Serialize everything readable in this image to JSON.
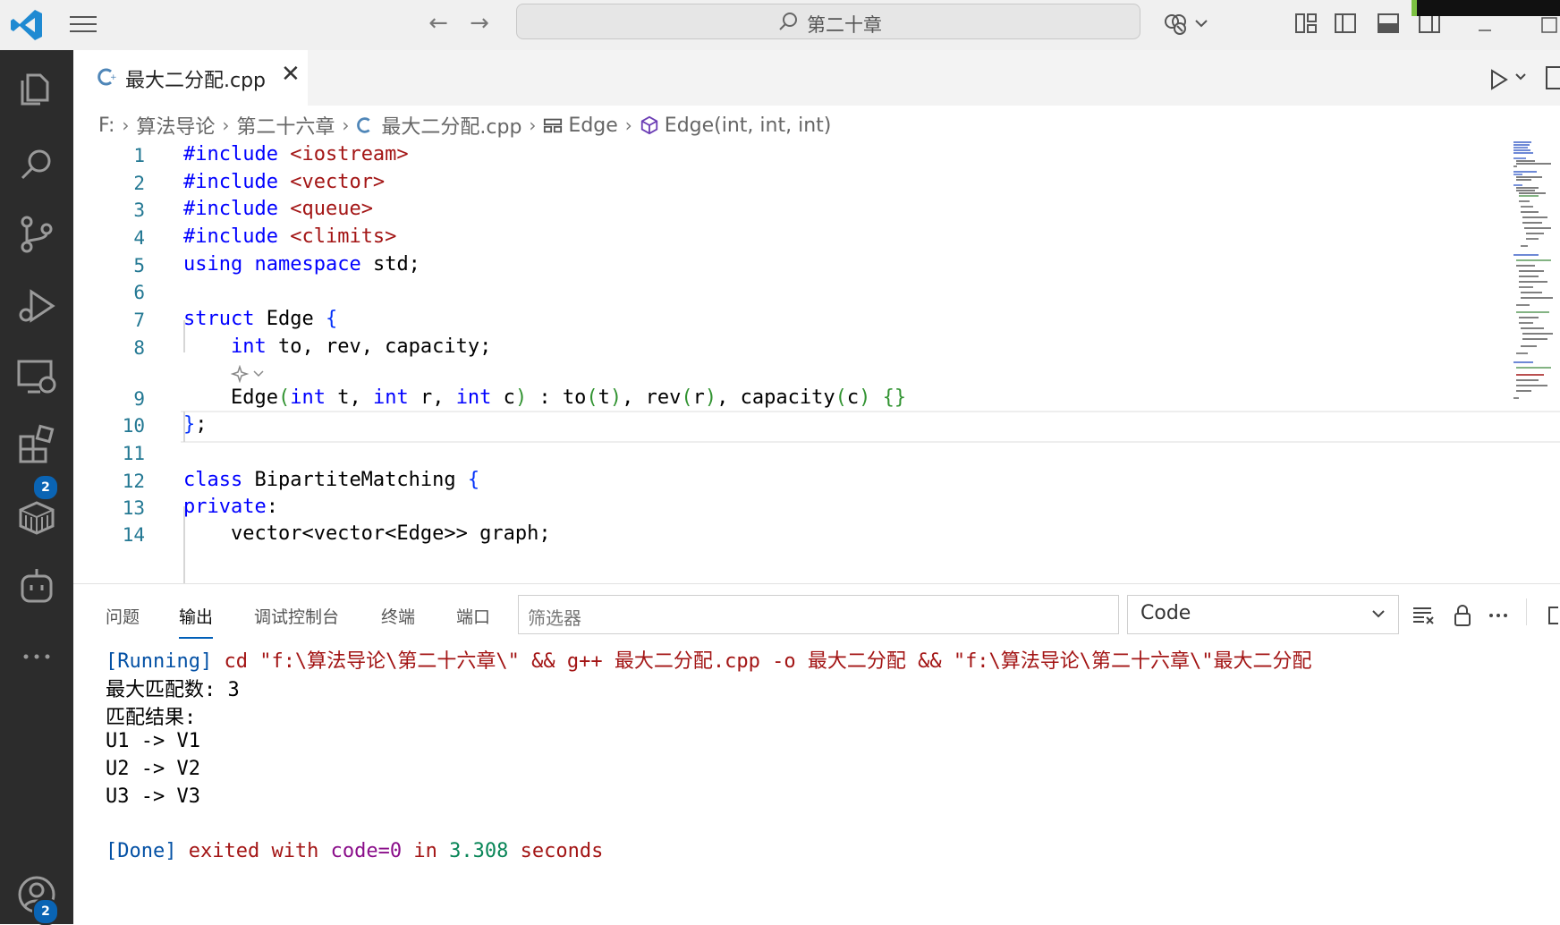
{
  "titlebar": {
    "search_text": "第二十章"
  },
  "tab": {
    "filename": "最大二分配.cpp",
    "close": "✕"
  },
  "breadcrumb": {
    "items": [
      "F:",
      "算法导论",
      "第二十六章",
      "最大二分配.cpp",
      "Edge",
      "Edge(int, int, int)"
    ]
  },
  "editor": {
    "line_numbers": [
      "1",
      "2",
      "3",
      "4",
      "5",
      "6",
      "7",
      "8",
      "9",
      "10",
      "11",
      "12",
      "13",
      "14"
    ]
  },
  "panel": {
    "tabs": [
      "问题",
      "输出",
      "调试控制台",
      "终端",
      "端口"
    ],
    "active_tab": "输出",
    "filter_placeholder": "筛选器",
    "channel": "Code",
    "output": {
      "running_tag": "[Running]",
      "running_cmd": " cd \"f:\\算法导论\\第二十六章\\\" && g++ 最大二分配.cpp -o 最大二分配 && \"f:\\算法导论\\第二十六章\\\"最大二分配",
      "line1": "最大匹配数: 3",
      "line2": "匹配结果:",
      "line3": "U1 -> V1",
      "line4": "U2 -> V2",
      "line5": "U3 -> V3",
      "done_tag": "[Done]",
      "done_exited": " exited with ",
      "done_code": "code=0",
      "done_in": " in ",
      "done_time": "3.308",
      "done_seconds": " seconds"
    }
  },
  "badges": {
    "extensions": "2",
    "accounts": "2"
  },
  "colors": {
    "accent": "#005fb8",
    "activity_bar": "#2c2c2c",
    "badge": "#0a64b4"
  }
}
